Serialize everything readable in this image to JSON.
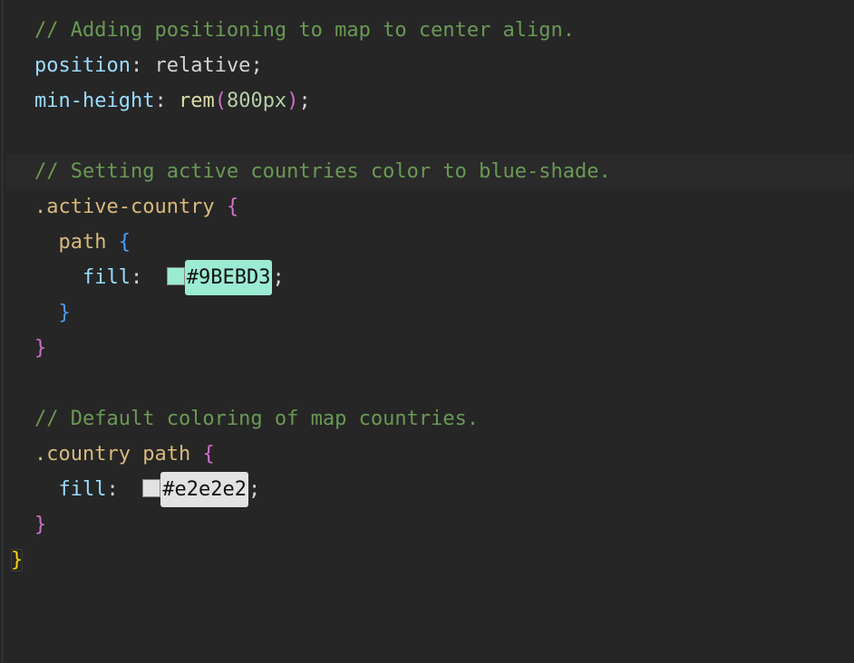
{
  "colors": {
    "active_country_swatch": "#9BEBD3",
    "country_swatch": "#e2e2e2",
    "bg": "#262626"
  },
  "indent": "  ",
  "lines": {
    "l1_comment": "// Adding positioning to map to center align.",
    "l2_prop": "position",
    "l2_colon": ": ",
    "l2_val": "relative",
    "l2_semi": ";",
    "l3_prop": "min-height",
    "l3_colon": ": ",
    "l3_func": "rem",
    "l3_open": "(",
    "l3_num": "800px",
    "l3_close": ")",
    "l3_semi": ";",
    "l5_comment": "// Setting active countries color to blue-shade.",
    "l6_selector": ".active-country",
    "l6_space": " ",
    "l6_brace": "{",
    "l7_selector": "path",
    "l7_space": " ",
    "l7_brace": "{",
    "l8_prop": "fill",
    "l8_colon": ":  ",
    "l8_hex": "#9BEBD3",
    "l8_semi": ";",
    "l9_brace": "}",
    "l10_brace": "}",
    "l12_comment": "// Default coloring of map countries.",
    "l13_selector": ".country path",
    "l13_space": " ",
    "l13_brace": "{",
    "l14_prop": "fill",
    "l14_colon": ":  ",
    "l14_hex": "#e2e2e2",
    "l14_semi": ";",
    "l15_brace": "}",
    "l16_brace": "}"
  }
}
